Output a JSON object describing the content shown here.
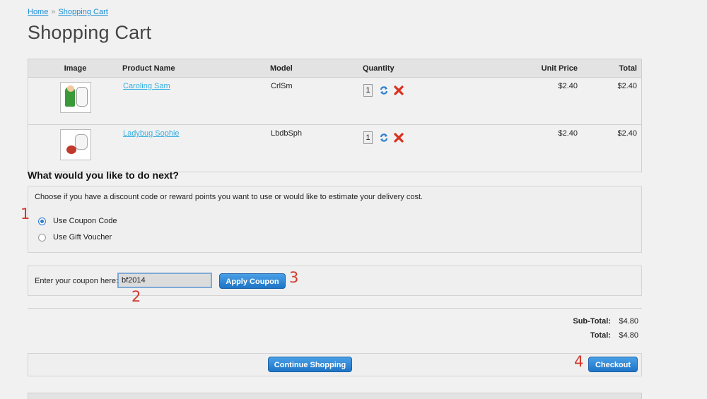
{
  "breadcrumb": {
    "home": "Home",
    "separator": "»",
    "current": "Shopping Cart"
  },
  "page_title": "Shopping Cart",
  "cart": {
    "headers": {
      "image": "Image",
      "name": "Product Name",
      "model": "Model",
      "quantity": "Quantity",
      "unit_price": "Unit Price",
      "total": "Total"
    },
    "items": [
      {
        "name": "Caroling Sam",
        "model": "CrlSm",
        "quantity": "1",
        "unit_price": "$2.40",
        "total": "$2.40"
      },
      {
        "name": "Ladybug Sophie",
        "model": "LbdbSph",
        "quantity": "1",
        "unit_price": "$2.40",
        "total": "$2.40"
      }
    ]
  },
  "next": {
    "heading": "What would you like to do next?",
    "description": "Choose if you have a discount code or reward points you want to use or would like to estimate your delivery cost.",
    "options": [
      {
        "label": "Use Coupon Code",
        "checked": true
      },
      {
        "label": "Use Gift Voucher",
        "checked": false
      }
    ]
  },
  "coupon": {
    "label": "Enter your coupon here:",
    "value": "bf2014",
    "apply_label": "Apply Coupon"
  },
  "totals": {
    "subtotal_label": "Sub-Total:",
    "subtotal": "$4.80",
    "total_label": "Total:",
    "total": "$4.80"
  },
  "actions": {
    "continue_label": "Continue Shopping",
    "checkout_label": "Checkout"
  },
  "annotations": [
    "1",
    "2",
    "3",
    "4"
  ],
  "colors": {
    "button": "#1e74c6",
    "annotation": "#d0392b",
    "link": "#1e8fd6"
  }
}
